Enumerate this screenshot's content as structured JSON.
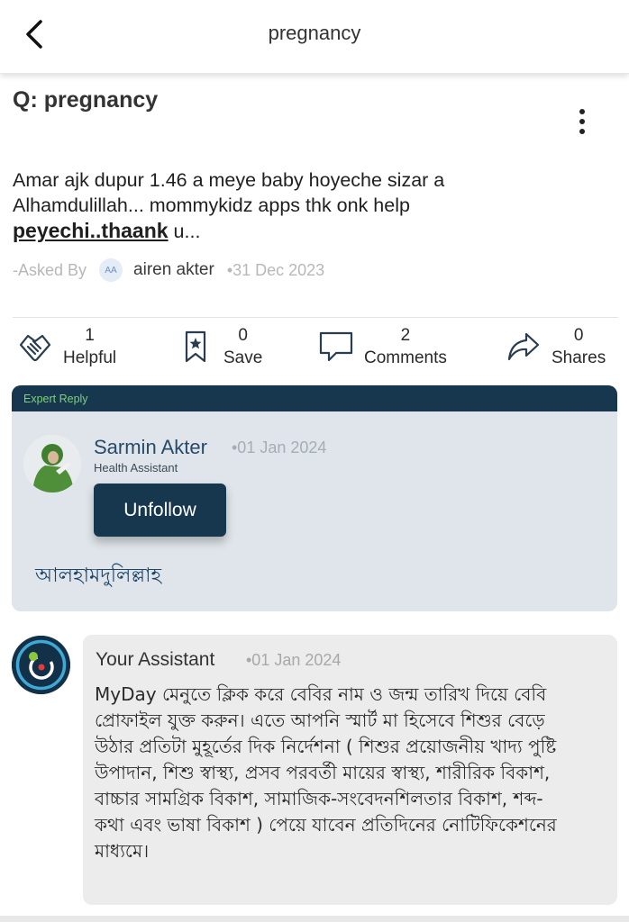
{
  "header": {
    "title": "pregnancy",
    "back_icon": "chevron-left-icon"
  },
  "question": {
    "title": "Q: pregnancy",
    "body_line1": "Amar ajk dupur 1.46 a meye baby hoyeche sizar a",
    "body_line2": "Alhamdulillah... mommykidz apps  thk onk help",
    "body_link": "peyechi..thaank",
    "body_tail": " u...",
    "asked_by_label": "-Asked By",
    "author_initials": "AA",
    "author_name": "airen akter",
    "date": "•31 Dec 2023",
    "more_icon": "more-vertical-icon"
  },
  "actions": [
    {
      "icon": "handshake-icon",
      "count": "1",
      "label": "Helpful"
    },
    {
      "icon": "bookmark-star-icon",
      "count": "0",
      "label": "Save"
    },
    {
      "icon": "comment-icon",
      "count": "2",
      "label": "Comments"
    },
    {
      "icon": "share-icon",
      "count": "0",
      "label": "Shares"
    }
  ],
  "expert": {
    "header": "Expert Reply",
    "name": "Sarmin Akter",
    "date": "•01 Jan 2024",
    "role": "Health Assistant",
    "button": "Unfollow",
    "reply": "আলহামদুলিল্লাহ"
  },
  "assistant": {
    "name": "Your Assistant",
    "date": "•01 Jan 2024",
    "lines": [
      "MyDay মেনুতে ক্লিক করে বেবির নাম ও জন্ম তারিখ দিয়ে বেবি",
      "প্রোফাইল যুক্ত করুন। এতে আপনি স্মার্ট মা হিসেবে শিশুর বেড়ে",
      "উঠার প্রতিটা মুহূর্তের দিক নির্দেশনা ( শিশুর প্রয়োজনীয় খাদ্য পুষ্টি",
      "উপাদান, শিশু স্বাস্থ্য, প্রসব পরবর্তী মায়ের স্বাস্থ্য, শারীরিক বিকাশ,",
      "বাচ্চার সামগ্রিক বিকাশ, সামাজিক-সংবেদনশিলতার বিকাশ, শব্দ-",
      "কথা এবং ভাষা বিকাশ ) পেয়ে যাবেন প্রতিদিনের নোটিফিকেশনের",
      "মাধ্যমে।"
    ]
  },
  "colors": {
    "navy": "#17374e",
    "expert_bg": "#dfe5ea",
    "expert_label": "#7ed07b",
    "assistant_bg": "#ececec",
    "name_blue": "#274a69"
  }
}
